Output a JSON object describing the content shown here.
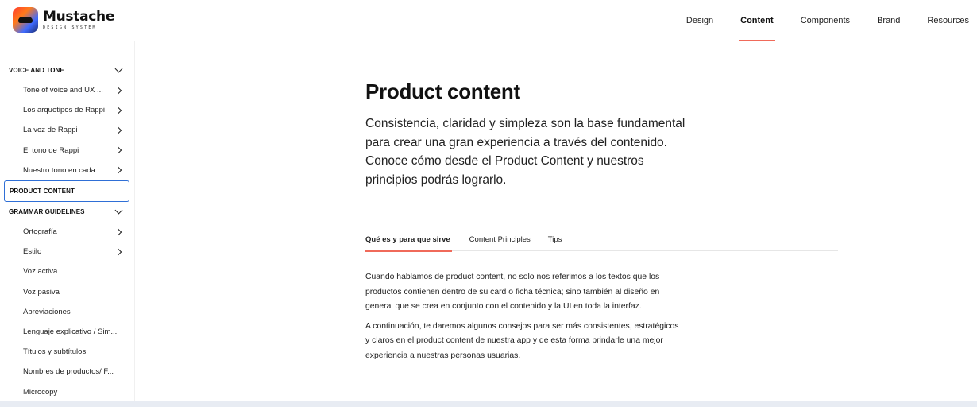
{
  "brand": {
    "name": "Mustache",
    "subtitle": "DESIGN SYSTEM"
  },
  "topnav": {
    "items": [
      {
        "label": "Design",
        "active": false
      },
      {
        "label": "Content",
        "active": true
      },
      {
        "label": "Components",
        "active": false
      },
      {
        "label": "Brand",
        "active": false
      },
      {
        "label": "Resources",
        "active": false
      }
    ]
  },
  "sidebar": {
    "voice_section": "VOICE AND TONE",
    "voice_items": [
      "Tone of voice and UX ...",
      "Los arquetipos de Rappi",
      "La voz de Rappi",
      "El tono de Rappi",
      "Nuestro tono en cada ..."
    ],
    "product_section": "PRODUCT CONTENT",
    "grammar_section": "GRAMMAR GUIDELINES",
    "grammar_items": [
      "Ortografía",
      "Estilo",
      "Voz activa",
      "Voz pasiva",
      "Abreviaciones",
      "Lenguaje explicativo / Sim...",
      "Títulos y subtítulos",
      "Nombres de productos/ F...",
      "Microcopy"
    ]
  },
  "main": {
    "title": "Product content",
    "intro_1": "Consistencia, claridad y simpleza son la base fundamental para crear una gran experiencia a través del contenido.",
    "intro_2": "Conoce cómo desde el Product Content  y nuestros principios podrás lograrlo.",
    "tabs": [
      "Qué es y para que sirve",
      "Content Principles",
      "Tips"
    ],
    "paragraph_1": "Cuando hablamos de product content, no solo nos referimos a los textos que los productos contienen dentro de su card o ficha técnica; sino también al diseño en general que se crea en conjunto con el contenido y la UI en toda la interfaz.",
    "paragraph_2": "A continuación, te daremos algunos consejos para ser más consistentes, estratégicos y claros en el product content de nuestra app y de esta forma brindarle una mejor experiencia a nuestras personas usuarias."
  },
  "colors": {
    "accent": "#f06a5a",
    "focus": "#2f6fd6"
  },
  "icons": {
    "section_toggle": "chevron-down-icon",
    "item_arrow": "chevron-right-icon"
  }
}
